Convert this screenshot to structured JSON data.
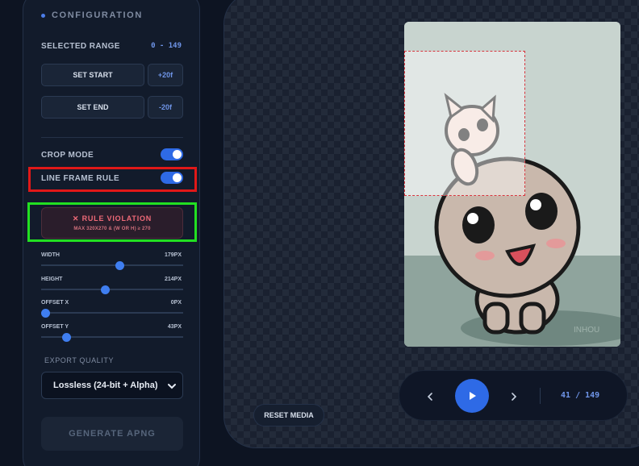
{
  "config": {
    "title": "CONFIGURATION",
    "selected_range_label": "SELECTED RANGE",
    "selected_range_value": "0 - 149",
    "set_start_label": "SET START",
    "start_step_label": "+20f",
    "set_end_label": "SET END",
    "end_step_label": "-20f",
    "crop_mode_label": "CROP MODE",
    "crop_mode_on": true,
    "line_frame_rule_label": "LINE FRAME RULE",
    "line_frame_rule_on": true,
    "violation": {
      "title": "RULE VIOLATION",
      "icon": "x-icon",
      "detail": "MAX 320X270 & (W OR H) ≥ 270"
    },
    "sliders": [
      {
        "label": "WIDTH",
        "value": "179PX",
        "fraction": 0.56
      },
      {
        "label": "HEIGHT",
        "value": "214PX",
        "fraction": 0.45
      },
      {
        "label": "OFFSET X",
        "value": "0PX",
        "fraction": 0.0
      },
      {
        "label": "OFFSET Y",
        "value": "43PX",
        "fraction": 0.16
      }
    ],
    "export_quality_label": "EXPORT QUALITY",
    "export_quality_value": "Lossless (24-bit + Alpha)",
    "generate_label": "GENERATE APNG"
  },
  "stage": {
    "reset_label": "RESET MEDIA",
    "frame_current": "41",
    "frame_total": "149",
    "frame_separator": "/",
    "media_watermark": "INHOU"
  },
  "colors": {
    "accent": "#2e6ae6",
    "violation": "#f06a78",
    "highlight_red": "#e01818",
    "highlight_green": "#22e022"
  }
}
